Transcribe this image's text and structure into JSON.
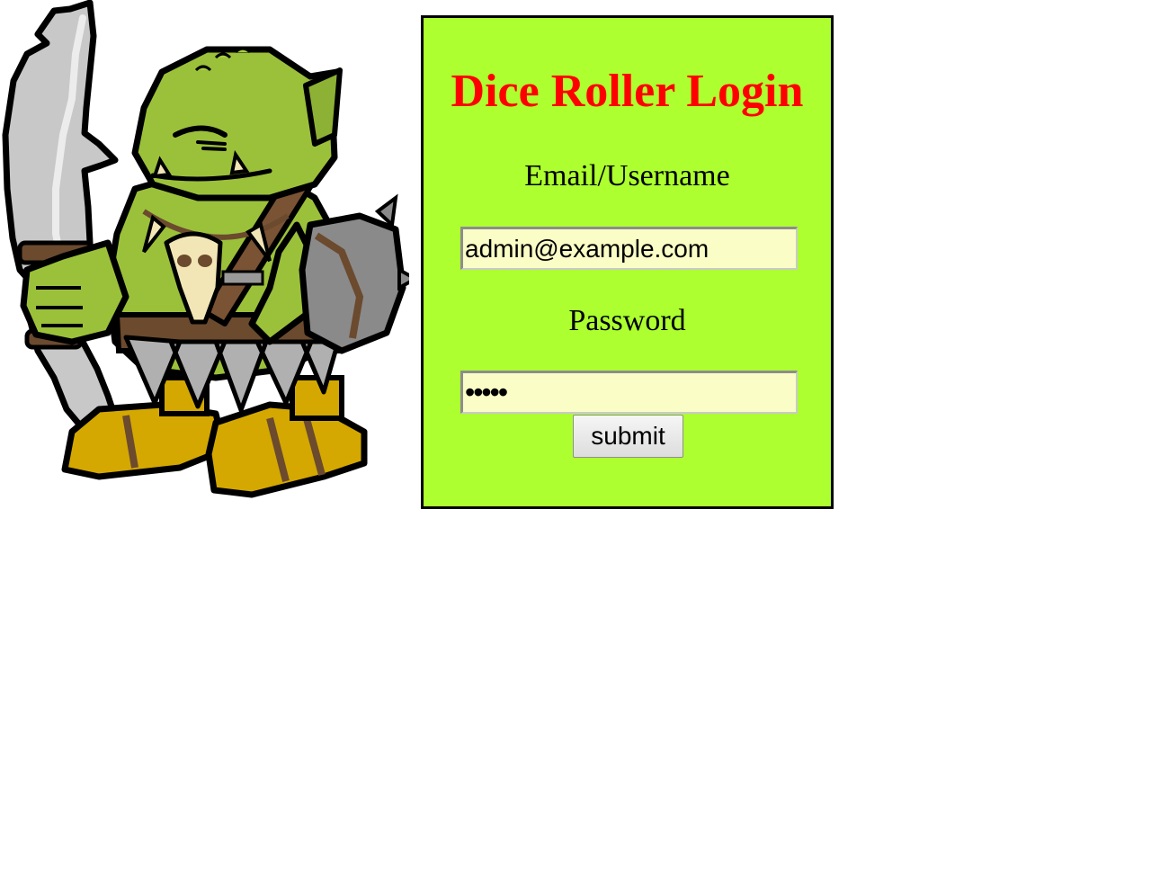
{
  "login": {
    "title": "Dice Roller Login",
    "email_label": "Email/Username",
    "email_value": "admin@example.com",
    "password_label": "Password",
    "password_value": "•••••",
    "submit_label": "submit"
  },
  "mascot": {
    "icon": "orc-warrior-illustration"
  },
  "colors": {
    "panel_background": "#adff2f",
    "title": "#ff0000",
    "input_background": "#fafdc6",
    "panel_border": "#000000"
  }
}
